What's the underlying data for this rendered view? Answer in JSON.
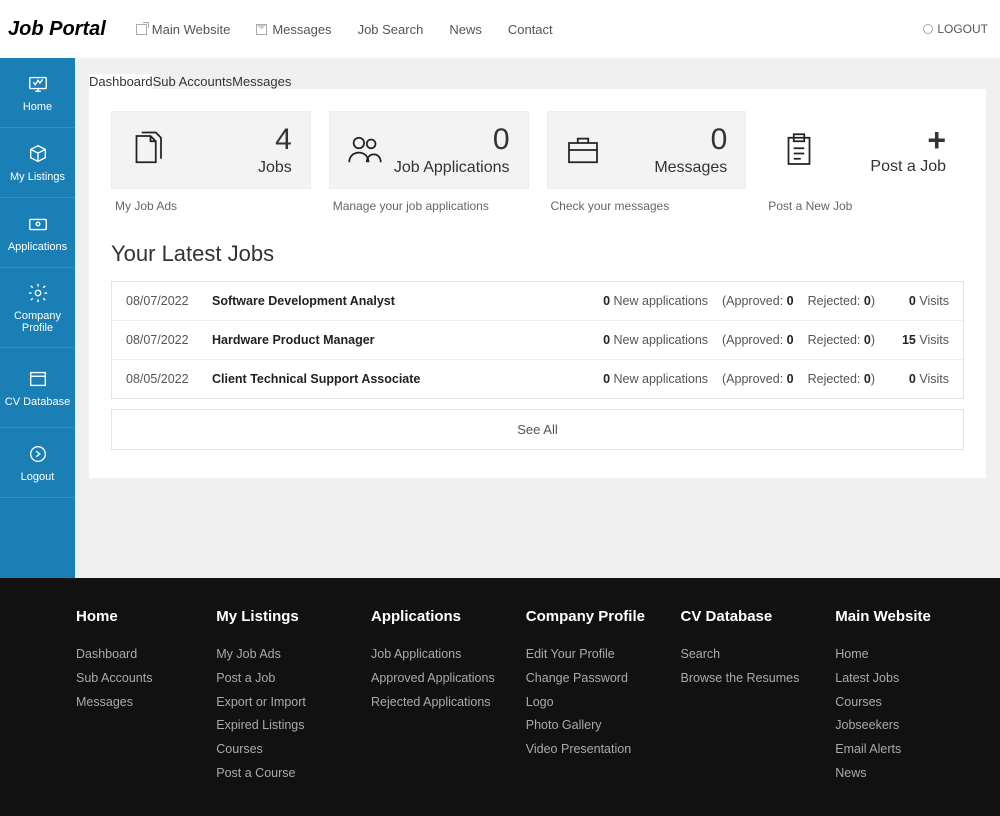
{
  "brand": "Job Portal",
  "topnav": {
    "main_website": "Main Website",
    "messages": "Messages",
    "job_search": "Job Search",
    "news": "News",
    "contact": "Contact"
  },
  "logout": "LOGOUT",
  "sidebar": {
    "home": "Home",
    "my_listings": "My Listings",
    "applications": "Applications",
    "company_profile": "Company Profile",
    "cv_database": "CV Database",
    "logout": "Logout"
  },
  "tabs": {
    "dashboard": "Dashboard",
    "sub_accounts": "Sub Accounts",
    "messages": "Messages"
  },
  "stats": {
    "jobs": {
      "value": "4",
      "label": "Jobs",
      "sub": "My Job Ads"
    },
    "apps": {
      "value": "0",
      "label": "Job Applications",
      "sub": "Manage your job applications"
    },
    "msgs": {
      "value": "0",
      "label": "Messages",
      "sub": "Check your messages"
    },
    "post": {
      "label": "Post a Job",
      "sub": "Post a New Job"
    }
  },
  "latest_title": "Your Latest Jobs",
  "jobs": [
    {
      "date": "08/07/2022",
      "title": "Software Development Analyst",
      "new": "0",
      "approved": "0",
      "rejected": "0",
      "visits": "0"
    },
    {
      "date": "08/07/2022",
      "title": "Hardware Product Manager",
      "new": "0",
      "approved": "0",
      "rejected": "0",
      "visits": "15"
    },
    {
      "date": "08/05/2022",
      "title": "Client Technical Support Associate",
      "new": "0",
      "approved": "0",
      "rejected": "0",
      "visits": "0"
    }
  ],
  "labels": {
    "new_applications": " New applications",
    "approved": "(Approved: ",
    "rejected": "Rejected: ",
    "visits": " Visits",
    "close_paren": ")"
  },
  "see_all": "See All",
  "footer": {
    "home": {
      "h": "Home",
      "links": [
        "Dashboard",
        "Sub Accounts",
        "Messages"
      ]
    },
    "listings": {
      "h": "My Listings",
      "links": [
        "My Job Ads",
        "Post a Job",
        "Export or Import",
        "Expired Listings",
        "Courses",
        "Post a Course"
      ]
    },
    "apps": {
      "h": "Applications",
      "links": [
        "Job Applications",
        "Approved Applications",
        "Rejected Applications"
      ]
    },
    "profile": {
      "h": "Company Profile",
      "links": [
        "Edit Your Profile",
        "Change Password",
        "Logo",
        "Photo Gallery",
        "Video Presentation"
      ]
    },
    "cv": {
      "h": "CV Database",
      "links": [
        "Search",
        "Browse the Resumes"
      ]
    },
    "mainweb": {
      "h": "Main Website",
      "links": [
        "Home",
        "Latest Jobs",
        "Courses",
        "Jobseekers",
        "Email Alerts",
        "News"
      ]
    }
  }
}
